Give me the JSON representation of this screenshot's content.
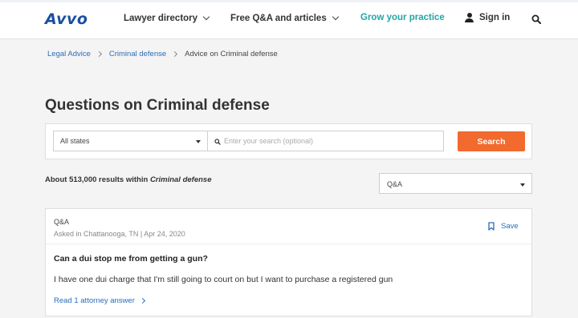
{
  "header": {
    "logo": "Avvo",
    "nav": {
      "lawyer_directory": "Lawyer directory",
      "free_qa": "Free Q&A and articles",
      "grow": "Grow your practice",
      "sign_in": "Sign in"
    }
  },
  "breadcrumb": {
    "items": [
      "Legal Advice",
      "Criminal defense"
    ],
    "current": "Advice on Criminal defense"
  },
  "page": {
    "title": "Questions on Criminal defense"
  },
  "search": {
    "state_selected": "All states",
    "query_placeholder": "Enter your search (optional)",
    "query_value": "",
    "button": "Search"
  },
  "results": {
    "prefix": "About 513,000 results within",
    "topic": "Criminal defense",
    "type_filter": "Q&A"
  },
  "cards": [
    {
      "type": "Q&A",
      "meta": "Asked in Chattanooga, TN | Apr 24, 2020",
      "save_label": "Save",
      "question": "Can a dui stop me from getting a gun?",
      "body": "I have one dui charge that I'm still going to court on but I want to purchase a registered gun",
      "link": "Read 1 attorney answer"
    }
  ],
  "colors": {
    "brand_blue": "#1a4fa0",
    "teal": "#23a5a5",
    "link_blue": "#2b6db8",
    "cta_orange": "#f26a2e"
  },
  "icons": [
    "user-icon",
    "search-icon",
    "chevron-down-icon",
    "chevron-right-icon",
    "bookmark-icon",
    "magnifier-icon",
    "caret-down-icon"
  ]
}
